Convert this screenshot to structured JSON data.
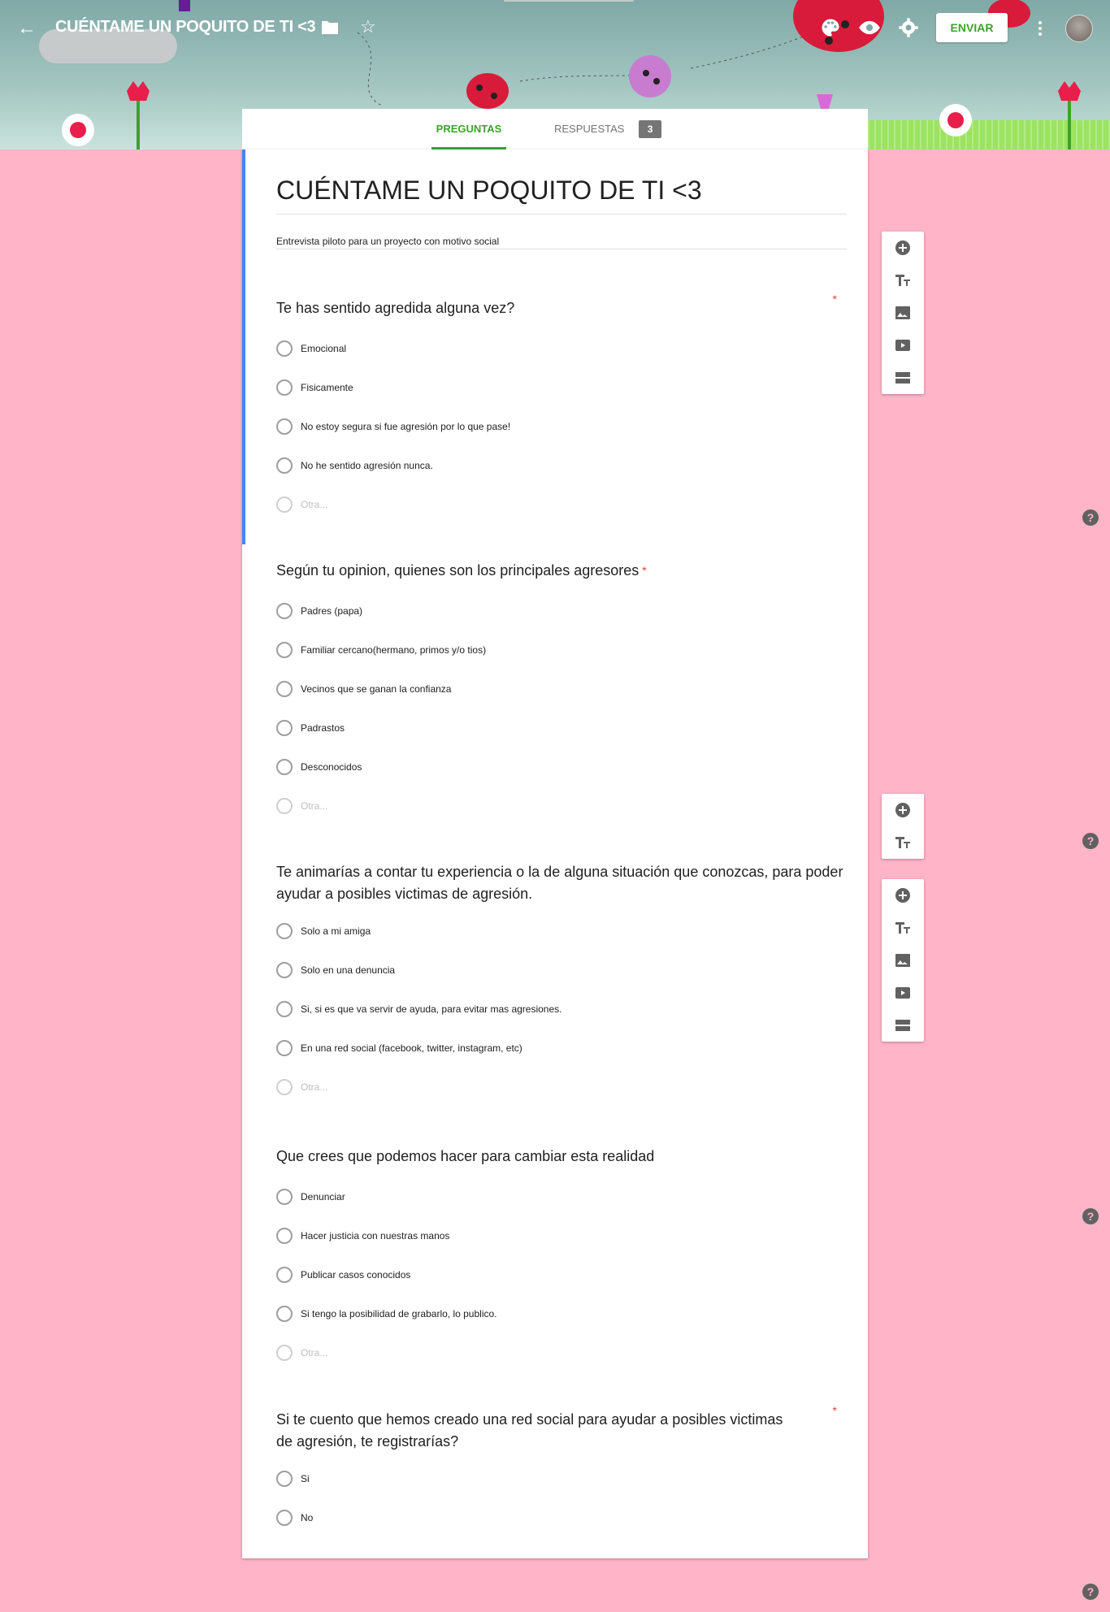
{
  "header": {
    "title": "CUÉNTAME UN POQUITO DE TI <3",
    "send_label": "ENVIAR"
  },
  "tabs": {
    "questions": "PREGUNTAS",
    "responses": "RESPUESTAS",
    "responses_count": "3"
  },
  "form": {
    "title": "CUÉNTAME UN POQUITO DE TI <3",
    "description": "Entrevista piloto para un proyecto con motivo social"
  },
  "questions": [
    {
      "title": "Te has sentido agredida alguna vez?",
      "required": "*",
      "options": [
        "Emocional",
        "Fisicamente",
        "No estoy segura si fue agresión por lo que pase!",
        "No he sentido agresión nunca."
      ],
      "other": "Otra..."
    },
    {
      "title": "Según tu opinion, quienes son los principales agresores",
      "required": "*",
      "options": [
        "Padres (papa)",
        "Familiar cercano(hermano, primos y/o tios)",
        "Vecinos que se ganan la confianza",
        "Padrastos",
        "Desconocidos"
      ],
      "other": "Otra..."
    },
    {
      "title": "Te animarías a contar tu experiencia o la de alguna situación que conozcas, para poder ayudar a posibles victimas de agresión.",
      "options": [
        "Solo a mi amiga",
        "Solo en una denuncia",
        "Si, si es que va servir de ayuda, para evitar mas agresiones.",
        "En una red social (facebook, twitter, instagram, etc)"
      ],
      "other": "Otra..."
    },
    {
      "title": "Que crees que podemos hacer para cambiar esta realidad",
      "options": [
        "Denunciar",
        "Hacer justicia con nuestras manos",
        "Publicar casos conocidos",
        "Si tengo la posibilidad de grabarlo, lo publico."
      ],
      "other": "Otra..."
    },
    {
      "title": "Si te cuento que hemos creado una red social para ayudar a posibles victimas de agresión, te registrarías?",
      "required": "*",
      "options": [
        "Si",
        "No"
      ]
    }
  ],
  "help": {
    "label": "?"
  },
  "colors": {
    "accent": "#3ea22a",
    "background": "#ffb4c8",
    "active": "#4285f4",
    "required": "#db4437"
  }
}
